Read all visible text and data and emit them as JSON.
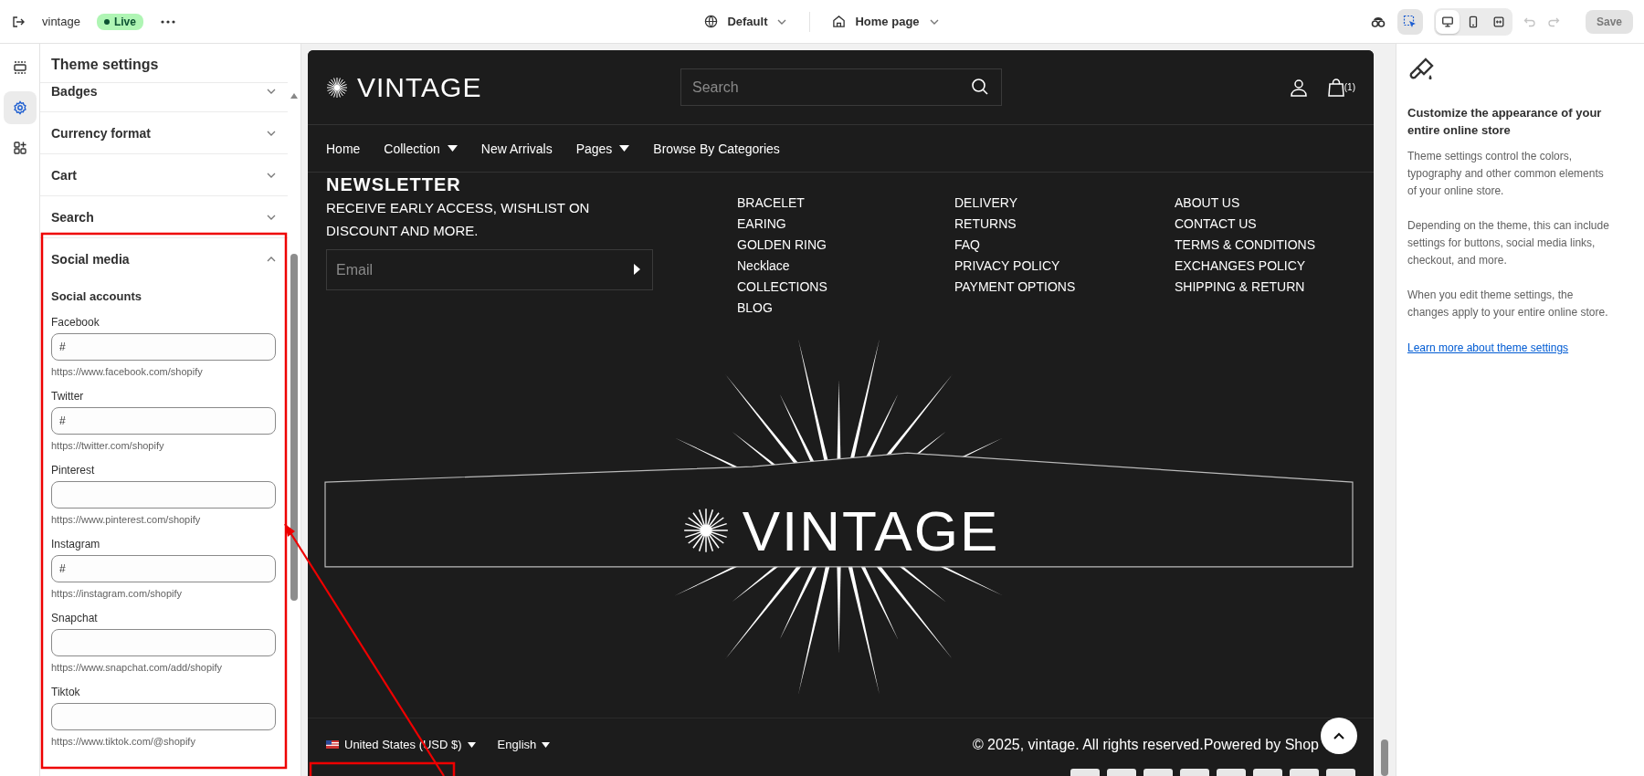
{
  "topbar": {
    "store_name": "vintage",
    "status": "Live",
    "theme": "Default",
    "page": "Home page",
    "save": {
      "label": "Save",
      "disabled": true
    },
    "inspector": {
      "selected": true
    },
    "devices": [
      {
        "kind": "desktop",
        "selected": true
      },
      {
        "kind": "mobile",
        "selected": false
      },
      {
        "kind": "fullwidth",
        "selected": false
      }
    ]
  },
  "rail": [
    {
      "kind": "sections",
      "selected": false
    },
    {
      "kind": "settings",
      "selected": true
    },
    {
      "kind": "apps",
      "selected": false
    }
  ],
  "panel": {
    "title": "Theme settings",
    "sections": [
      {
        "label": "Badges",
        "expanded": false
      },
      {
        "label": "Currency format",
        "expanded": false
      },
      {
        "label": "Cart",
        "expanded": false
      },
      {
        "label": "Search",
        "expanded": false
      },
      {
        "label": "Social media",
        "expanded": true
      }
    ],
    "subheading": "Social accounts",
    "fields": [
      {
        "label": "Facebook",
        "value": "#",
        "help": "https://www.facebook.com/shopify"
      },
      {
        "label": "Twitter",
        "value": "#",
        "help": "https://twitter.com/shopify"
      },
      {
        "label": "Pinterest",
        "help": "https://www.pinterest.com/shopify"
      },
      {
        "label": "Instagram",
        "value": "#",
        "help": "https://instagram.com/shopify"
      },
      {
        "label": "Snapchat",
        "help": "https://www.snapchat.com/add/shopify"
      },
      {
        "label": "Tiktok",
        "help": "https://www.tiktok.com/@shopify"
      }
    ]
  },
  "preview": {
    "logo": "VINTAGE",
    "search": {
      "placeholder": "Search"
    },
    "cart_count": "(1)",
    "nav": [
      {
        "label": "Home",
        "dropdown": false
      },
      {
        "label": "Collection",
        "dropdown": true
      },
      {
        "label": "New Arrivals",
        "dropdown": false
      },
      {
        "label": "Pages",
        "dropdown": true
      },
      {
        "label": "Browse By Categories",
        "dropdown": false
      }
    ],
    "newsletter": {
      "heading": "NEWSLETTER",
      "text": "RECEIVE EARLY ACCESS, WISHLIST ON DISCOUNT AND MORE.",
      "email": {
        "placeholder": "Email"
      }
    },
    "link_columns": [
      [
        "BRACELET",
        "EARING",
        "GOLDEN RING",
        "Necklace",
        "COLLECTIONS",
        "BLOG"
      ],
      [
        "DELIVERY",
        "RETURNS",
        "FAQ",
        "PRIVACY POLICY",
        "PAYMENT OPTIONS"
      ],
      [
        "ABOUT US",
        "CONTACT US",
        "TERMS & CONDITIONS",
        "EXCHANGES POLICY",
        "SHIPPING & RETURN"
      ]
    ],
    "banner_logo": "VINTAGE",
    "country": "United States (USD $)",
    "language": "English",
    "copyright": "© 2025, vintage. All rights reserved.Powered by Shop"
  },
  "info": {
    "heading": "Customize the appearance of your entire online store",
    "paragraphs": [
      "Theme settings control the colors, typography and other common elements of your online store.",
      "Depending on the theme, this can include settings for buttons, social media links, checkout, and more.",
      "When you edit theme settings, the changes apply to your entire online store."
    ],
    "link": "Learn more about theme settings"
  }
}
